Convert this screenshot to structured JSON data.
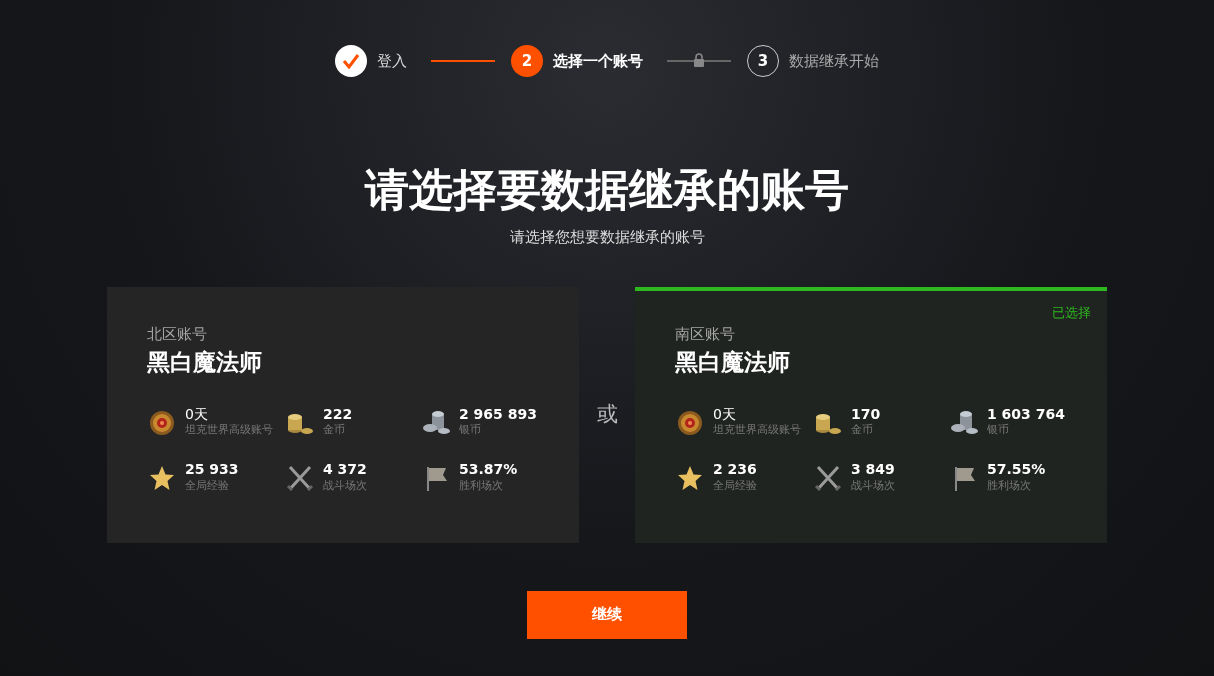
{
  "steps": [
    {
      "label": "登入",
      "completed": true,
      "selected": false
    },
    {
      "number": "2",
      "label": "选择一个账号",
      "completed": false,
      "selected": true,
      "connector_done": true,
      "locked": false
    },
    {
      "number": "3",
      "label": "数据继承开始",
      "completed": false,
      "selected": false,
      "connector_done": false,
      "locked": true
    }
  ],
  "title": "请选择要数据继承的账号",
  "subtitle": "请选择您想要数据继承的账号",
  "separator": "或",
  "accounts": [
    {
      "region": "北区账号",
      "name": "黑白魔法师",
      "selected": false,
      "stats": [
        {
          "kind": "premium",
          "value": "0天",
          "label": "坦克世界高级账号"
        },
        {
          "kind": "gold",
          "value": "222",
          "label": "金币"
        },
        {
          "kind": "silver",
          "value": "2 965 893",
          "label": "银币"
        },
        {
          "kind": "xp",
          "value": "25 933",
          "label": "全局经验"
        },
        {
          "kind": "battles",
          "value": "4 372",
          "label": "战斗场次"
        },
        {
          "kind": "wins",
          "value": "53.87%",
          "label": "胜利场次"
        }
      ]
    },
    {
      "region": "南区账号",
      "name": "黑白魔法师",
      "selected": true,
      "selected_label": "已选择",
      "stats": [
        {
          "kind": "premium",
          "value": "0天",
          "label": "坦克世界高级账号"
        },
        {
          "kind": "gold",
          "value": "170",
          "label": "金币"
        },
        {
          "kind": "silver",
          "value": "1 603 764",
          "label": "银币"
        },
        {
          "kind": "xp",
          "value": "2 236",
          "label": "全局经验"
        },
        {
          "kind": "battles",
          "value": "3 849",
          "label": "战斗场次"
        },
        {
          "kind": "wins",
          "value": "57.55%",
          "label": "胜利场次"
        }
      ]
    }
  ],
  "continue_button": "继续"
}
